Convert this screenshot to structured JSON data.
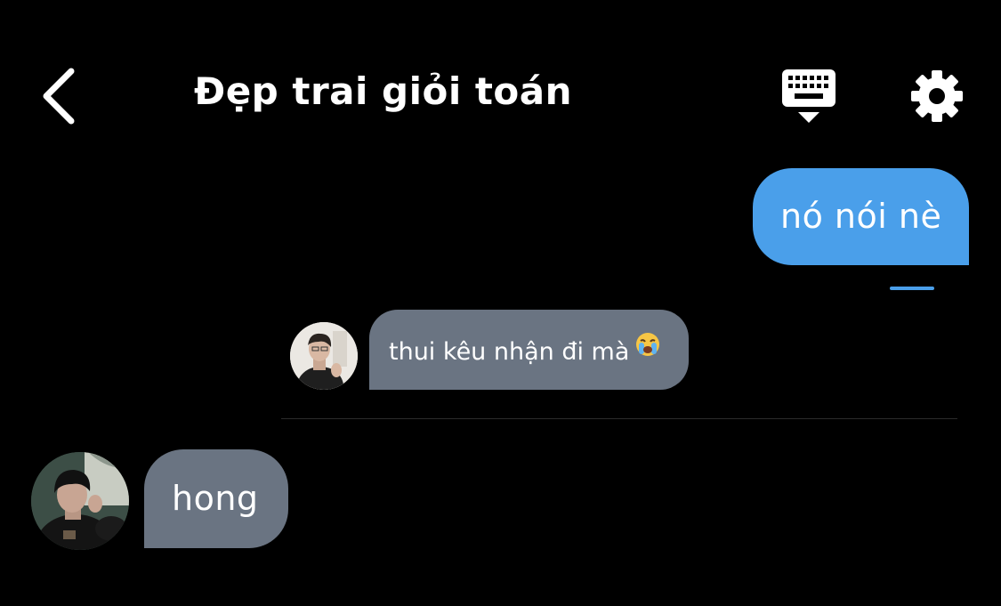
{
  "header": {
    "title": "Đẹp trai giỏi toán",
    "back_icon": "chevron-left-icon",
    "keyboard_icon": "keyboard-icon",
    "settings_icon": "gear-icon"
  },
  "messages": [
    {
      "direction": "outgoing",
      "text": "nó nói nè"
    },
    {
      "direction": "incoming",
      "text": "thui kêu nhận đi mà",
      "emoji": "loudly-crying-face"
    },
    {
      "direction": "incoming",
      "text": "hong"
    }
  ],
  "colors": {
    "background": "#000000",
    "outgoing_bubble": "#4a9fea",
    "incoming_bubble": "#6a7482",
    "text": "#ffffff"
  }
}
